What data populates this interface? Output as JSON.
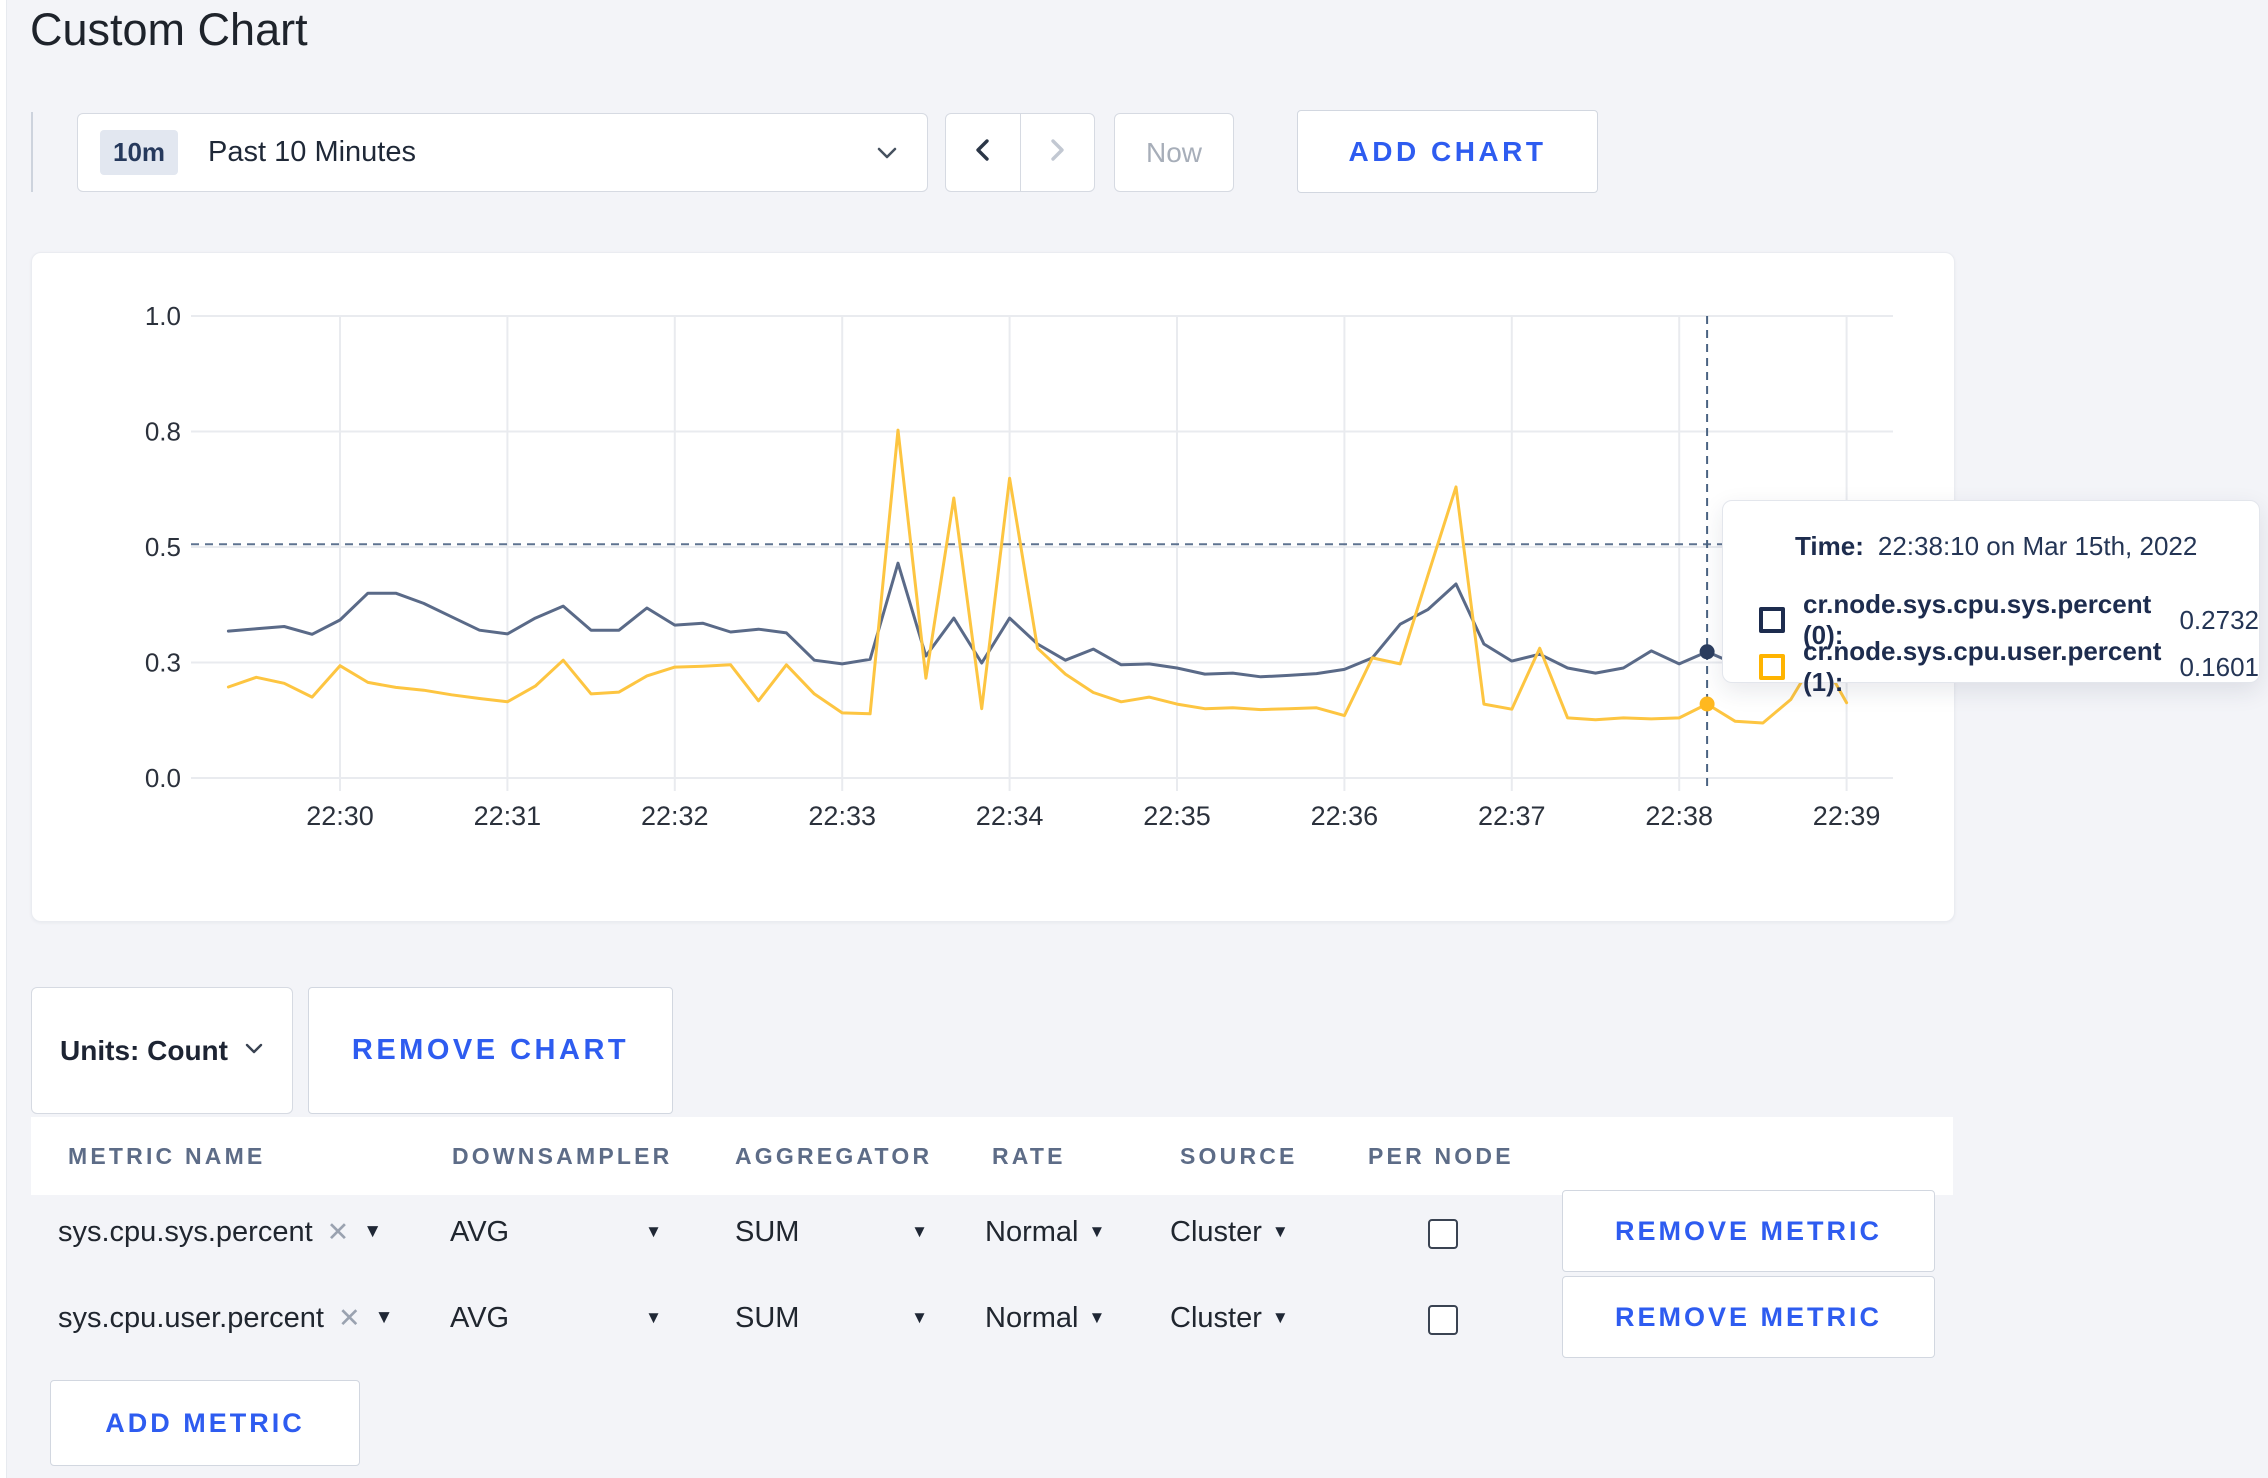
{
  "page": {
    "title": "Custom Chart",
    "background": "#f3f4f8",
    "accent_blue": "#2e5cf0"
  },
  "icons": {
    "dropdown_arrow": "▼",
    "clear": "✕"
  },
  "toolbar": {
    "time_range": {
      "badge": "10m",
      "label": "Past 10 Minutes"
    },
    "now_label": "Now",
    "add_chart_label": "ADD CHART"
  },
  "tooltip": {
    "time_label": "Time:",
    "time_value": "22:38:10 on Mar 15th, 2022",
    "rows": [
      {
        "name": "cr.node.sys.cpu.sys.percent (0):",
        "value": "0.2732",
        "color": "#1d2c4e"
      },
      {
        "name": "cr.node.sys.cpu.user.percent (1):",
        "value": "0.1601",
        "color": "#ffb400"
      }
    ]
  },
  "units_bar": {
    "units_label": "Units: Count",
    "remove_chart_label": "REMOVE CHART"
  },
  "metrics_table": {
    "headers": [
      "METRIC NAME",
      "DOWNSAMPLER",
      "AGGREGATOR",
      "RATE",
      "SOURCE",
      "PER NODE"
    ],
    "rows": [
      {
        "metric": "sys.cpu.sys.percent",
        "downsampler": "AVG",
        "aggregator": "SUM",
        "rate": "Normal",
        "source": "Cluster",
        "per_node_checked": false,
        "remove_label": "REMOVE METRIC"
      },
      {
        "metric": "sys.cpu.user.percent",
        "downsampler": "AVG",
        "aggregator": "SUM",
        "rate": "Normal",
        "source": "Cluster",
        "per_node_checked": false,
        "remove_label": "REMOVE METRIC"
      }
    ],
    "add_metric_label": "ADD METRIC"
  },
  "chart_data": {
    "type": "line",
    "title": "",
    "xlabel": "",
    "ylabel": "",
    "ylim": [
      0,
      1
    ],
    "grid": true,
    "legend_position": "tooltip",
    "x_ticks": [
      "22:30",
      "22:31",
      "22:32",
      "22:33",
      "22:34",
      "22:35",
      "22:36",
      "22:37",
      "22:38",
      "22:39"
    ],
    "y_ticks": [
      {
        "v": 0,
        "label": "0.0"
      },
      {
        "v": 0.25,
        "label": "0.3"
      },
      {
        "v": 0.5,
        "label": "0.5"
      },
      {
        "v": 0.75,
        "label": "0.8"
      },
      {
        "v": 1.0,
        "label": "1.0"
      }
    ],
    "crosshair": {
      "time": "22:38:10",
      "value": 0.506
    },
    "hover_points": [
      {
        "series": 0,
        "time": "22:38:10",
        "value": 0.2732,
        "dot_color": "#2c3e5f"
      },
      {
        "series": 1,
        "time": "22:38:10",
        "value": 0.1601,
        "dot_color": "#ffb81f"
      }
    ],
    "series": [
      {
        "name": "cr.node.sys.cpu.sys.percent (0)",
        "color": "#5a6a88",
        "points": [
          [
            "22:29:20",
            0.318
          ],
          [
            "22:29:30",
            0.323
          ],
          [
            "22:29:40",
            0.328
          ],
          [
            "22:29:50",
            0.311
          ],
          [
            "22:30:00",
            0.342
          ],
          [
            "22:30:10",
            0.4
          ],
          [
            "22:30:20",
            0.4
          ],
          [
            "22:30:30",
            0.378
          ],
          [
            "22:30:40",
            0.349
          ],
          [
            "22:30:50",
            0.32
          ],
          [
            "22:31:00",
            0.312
          ],
          [
            "22:31:10",
            0.346
          ],
          [
            "22:31:20",
            0.372
          ],
          [
            "22:31:30",
            0.32
          ],
          [
            "22:31:40",
            0.32
          ],
          [
            "22:31:50",
            0.368
          ],
          [
            "22:32:00",
            0.331
          ],
          [
            "22:32:10",
            0.335
          ],
          [
            "22:32:20",
            0.316
          ],
          [
            "22:32:30",
            0.322
          ],
          [
            "22:32:40",
            0.314
          ],
          [
            "22:32:50",
            0.255
          ],
          [
            "22:33:00",
            0.247
          ],
          [
            "22:33:10",
            0.257
          ],
          [
            "22:33:20",
            0.465
          ],
          [
            "22:33:30",
            0.264
          ],
          [
            "22:33:40",
            0.346
          ],
          [
            "22:33:50",
            0.249
          ],
          [
            "22:34:00",
            0.346
          ],
          [
            "22:34:10",
            0.29
          ],
          [
            "22:34:20",
            0.255
          ],
          [
            "22:34:30",
            0.279
          ],
          [
            "22:34:40",
            0.245
          ],
          [
            "22:34:50",
            0.247
          ],
          [
            "22:35:00",
            0.238
          ],
          [
            "22:35:10",
            0.225
          ],
          [
            "22:35:20",
            0.227
          ],
          [
            "22:35:30",
            0.219
          ],
          [
            "22:35:40",
            0.222
          ],
          [
            "22:35:50",
            0.226
          ],
          [
            "22:36:00",
            0.235
          ],
          [
            "22:36:10",
            0.26
          ],
          [
            "22:36:20",
            0.333
          ],
          [
            "22:36:30",
            0.365
          ],
          [
            "22:36:40",
            0.42
          ],
          [
            "22:36:50",
            0.29
          ],
          [
            "22:37:00",
            0.253
          ],
          [
            "22:37:10",
            0.268
          ],
          [
            "22:37:20",
            0.238
          ],
          [
            "22:37:30",
            0.227
          ],
          [
            "22:37:40",
            0.238
          ],
          [
            "22:37:50",
            0.275
          ],
          [
            "22:38:00",
            0.247
          ],
          [
            "22:38:10",
            0.2732
          ],
          [
            "22:38:20",
            0.247
          ]
        ]
      },
      {
        "name": "cr.node.sys.cpu.user.percent (1)",
        "color": "#fdc541",
        "points": [
          [
            "22:29:20",
            0.197
          ],
          [
            "22:29:30",
            0.218
          ],
          [
            "22:29:40",
            0.205
          ],
          [
            "22:29:50",
            0.175
          ],
          [
            "22:30:00",
            0.243
          ],
          [
            "22:30:10",
            0.207
          ],
          [
            "22:30:20",
            0.196
          ],
          [
            "22:30:30",
            0.19
          ],
          [
            "22:30:40",
            0.18
          ],
          [
            "22:30:50",
            0.172
          ],
          [
            "22:31:00",
            0.165
          ],
          [
            "22:31:10",
            0.199
          ],
          [
            "22:31:20",
            0.255
          ],
          [
            "22:31:30",
            0.182
          ],
          [
            "22:31:40",
            0.186
          ],
          [
            "22:31:50",
            0.221
          ],
          [
            "22:32:00",
            0.24
          ],
          [
            "22:32:10",
            0.242
          ],
          [
            "22:32:20",
            0.245
          ],
          [
            "22:32:30",
            0.167
          ],
          [
            "22:32:40",
            0.245
          ],
          [
            "22:32:50",
            0.182
          ],
          [
            "22:33:00",
            0.141
          ],
          [
            "22:33:10",
            0.139
          ],
          [
            "22:33:20",
            0.753
          ],
          [
            "22:33:30",
            0.216
          ],
          [
            "22:33:40",
            0.606
          ],
          [
            "22:33:50",
            0.15
          ],
          [
            "22:34:00",
            0.649
          ],
          [
            "22:34:10",
            0.281
          ],
          [
            "22:34:20",
            0.225
          ],
          [
            "22:34:30",
            0.185
          ],
          [
            "22:34:40",
            0.165
          ],
          [
            "22:34:50",
            0.175
          ],
          [
            "22:35:00",
            0.16
          ],
          [
            "22:35:10",
            0.15
          ],
          [
            "22:35:20",
            0.152
          ],
          [
            "22:35:30",
            0.148
          ],
          [
            "22:35:40",
            0.15
          ],
          [
            "22:35:50",
            0.152
          ],
          [
            "22:36:00",
            0.135
          ],
          [
            "22:36:10",
            0.26
          ],
          [
            "22:36:20",
            0.247
          ],
          [
            "22:36:30",
            0.44
          ],
          [
            "22:36:40",
            0.63
          ],
          [
            "22:36:50",
            0.16
          ],
          [
            "22:37:00",
            0.149
          ],
          [
            "22:37:10",
            0.281
          ],
          [
            "22:37:20",
            0.13
          ],
          [
            "22:37:30",
            0.126
          ],
          [
            "22:37:40",
            0.13
          ],
          [
            "22:37:50",
            0.128
          ],
          [
            "22:38:00",
            0.13
          ],
          [
            "22:38:10",
            0.1601
          ],
          [
            "22:38:20",
            0.123
          ],
          [
            "22:38:30",
            0.119
          ],
          [
            "22:38:40",
            0.17
          ],
          [
            "22:38:50",
            0.27
          ],
          [
            "22:39:00",
            0.163
          ]
        ]
      }
    ]
  }
}
